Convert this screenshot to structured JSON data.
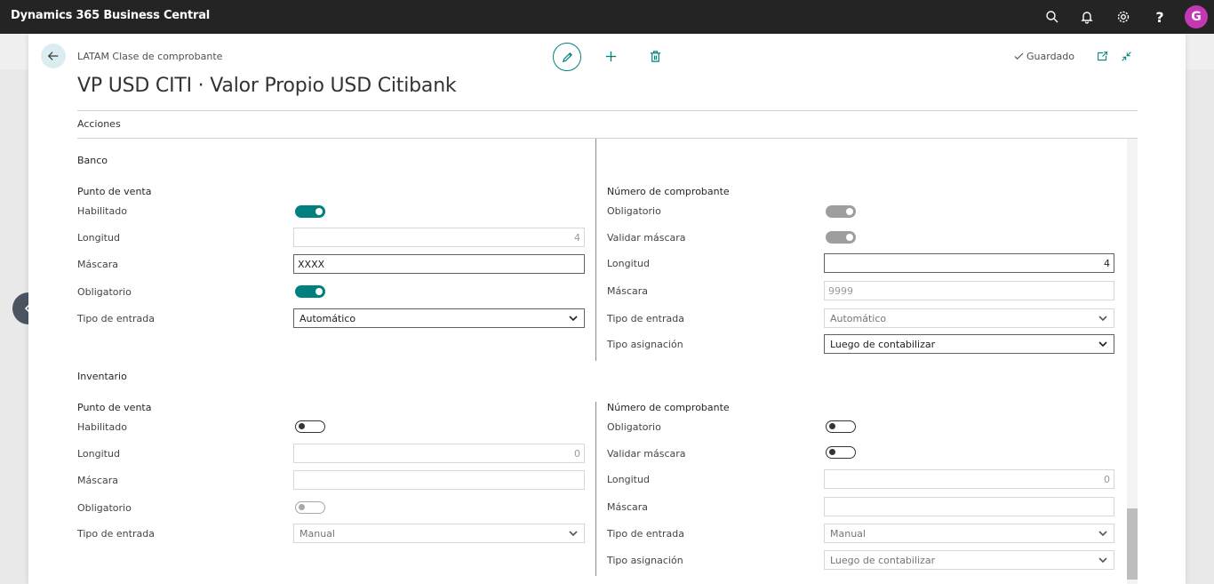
{
  "app": {
    "title": "Dynamics 365 Business Central",
    "avatar_initial": "G",
    "avatar_color": "#c239b3"
  },
  "header": {
    "caption": "LATAM Clase de comprobante",
    "title": "VP USD CITI · Valor Propio USD Citibank",
    "saved": "Guardado",
    "actions": "Acciones"
  },
  "accent": "#00807f",
  "banco": {
    "title": "Banco",
    "left": {
      "group": "Punto de venta",
      "habilitado_label": "Habilitado",
      "habilitado": true,
      "longitud_label": "Longitud",
      "longitud": "4",
      "mascara_label": "Máscara",
      "mascara": "XXXX",
      "obligatorio_label": "Obligatorio",
      "obligatorio": true,
      "tipo_entrada_label": "Tipo de entrada",
      "tipo_entrada": "Automático"
    },
    "right": {
      "group": "Número de comprobante",
      "obligatorio_label": "Obligatorio",
      "obligatorio": true,
      "validar_label": "Validar máscara",
      "validar": true,
      "longitud_label": "Longitud",
      "longitud": "4",
      "mascara_label": "Máscara",
      "mascara": "9999",
      "tipo_entrada_label": "Tipo de entrada",
      "tipo_entrada": "Automático",
      "tipo_asignacion_label": "Tipo asignación",
      "tipo_asignacion": "Luego de contabilizar"
    }
  },
  "inventario": {
    "title": "Inventario",
    "left": {
      "group": "Punto de venta",
      "habilitado_label": "Habilitado",
      "habilitado": false,
      "longitud_label": "Longitud",
      "longitud": "0",
      "mascara_label": "Máscara",
      "mascara": "",
      "obligatorio_label": "Obligatorio",
      "obligatorio": false,
      "tipo_entrada_label": "Tipo de entrada",
      "tipo_entrada": "Manual"
    },
    "right": {
      "group": "Número de comprobante",
      "obligatorio_label": "Obligatorio",
      "obligatorio": false,
      "validar_label": "Validar máscara",
      "validar": false,
      "longitud_label": "Longitud",
      "longitud": "0",
      "mascara_label": "Máscara",
      "mascara": "",
      "tipo_entrada_label": "Tipo de entrada",
      "tipo_entrada": "Manual",
      "tipo_asignacion_label": "Tipo asignación",
      "tipo_asignacion": "Luego de contabilizar"
    }
  }
}
